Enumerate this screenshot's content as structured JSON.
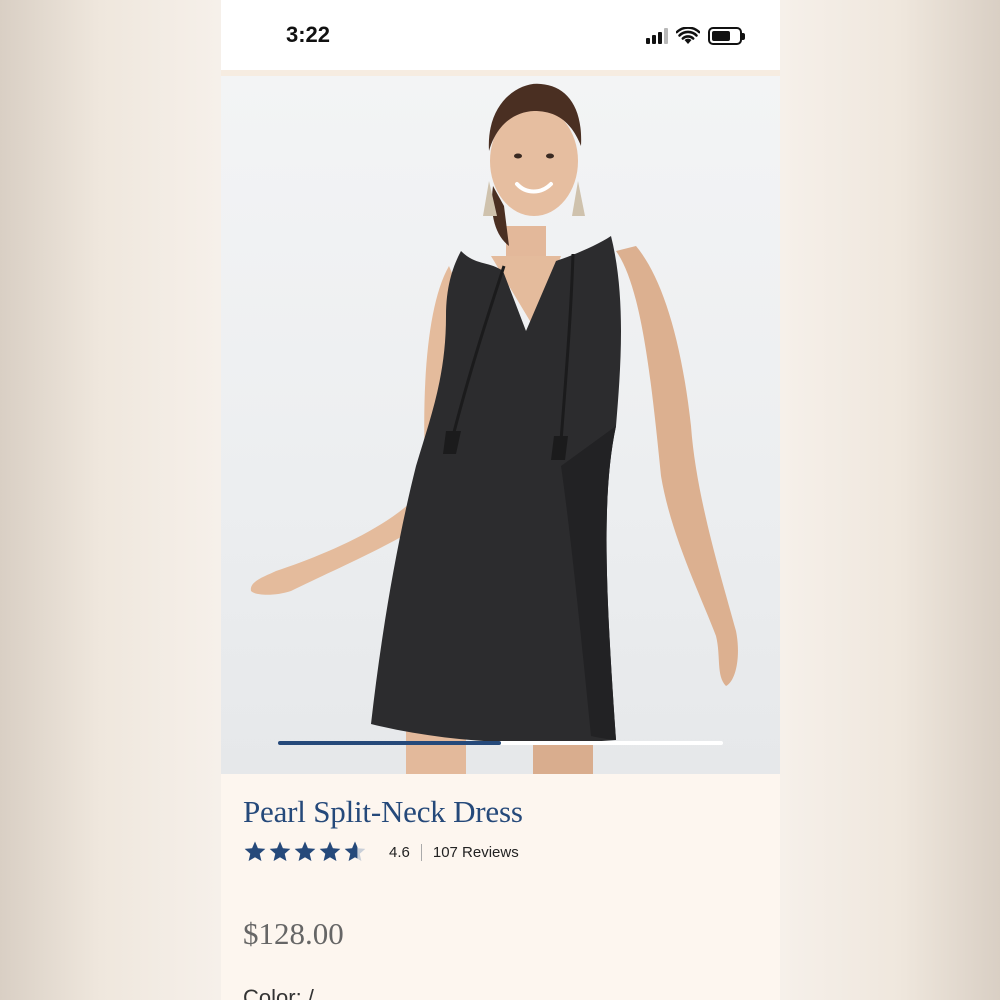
{
  "status_bar": {
    "time": "3:22",
    "signal_bars_active": 3,
    "battery_level": 0.7
  },
  "product": {
    "image_alt": "Model wearing black sleeveless split-neck dress with tassel ties",
    "carousel_progress": 0.5,
    "title": "Pearl Split-Neck Dress",
    "rating": 4.6,
    "rating_display": "4.6",
    "review_count_label": "107 Reviews",
    "price": "$128.00",
    "color_label": "Color: / "
  },
  "colors": {
    "brand_blue": "#25497a",
    "star_color": "#25497a",
    "page_background": "#fdf6ef"
  },
  "icons": {
    "signal": "cellular-signal-icon",
    "wifi": "wifi-icon",
    "battery": "battery-icon",
    "star": "star-icon"
  }
}
